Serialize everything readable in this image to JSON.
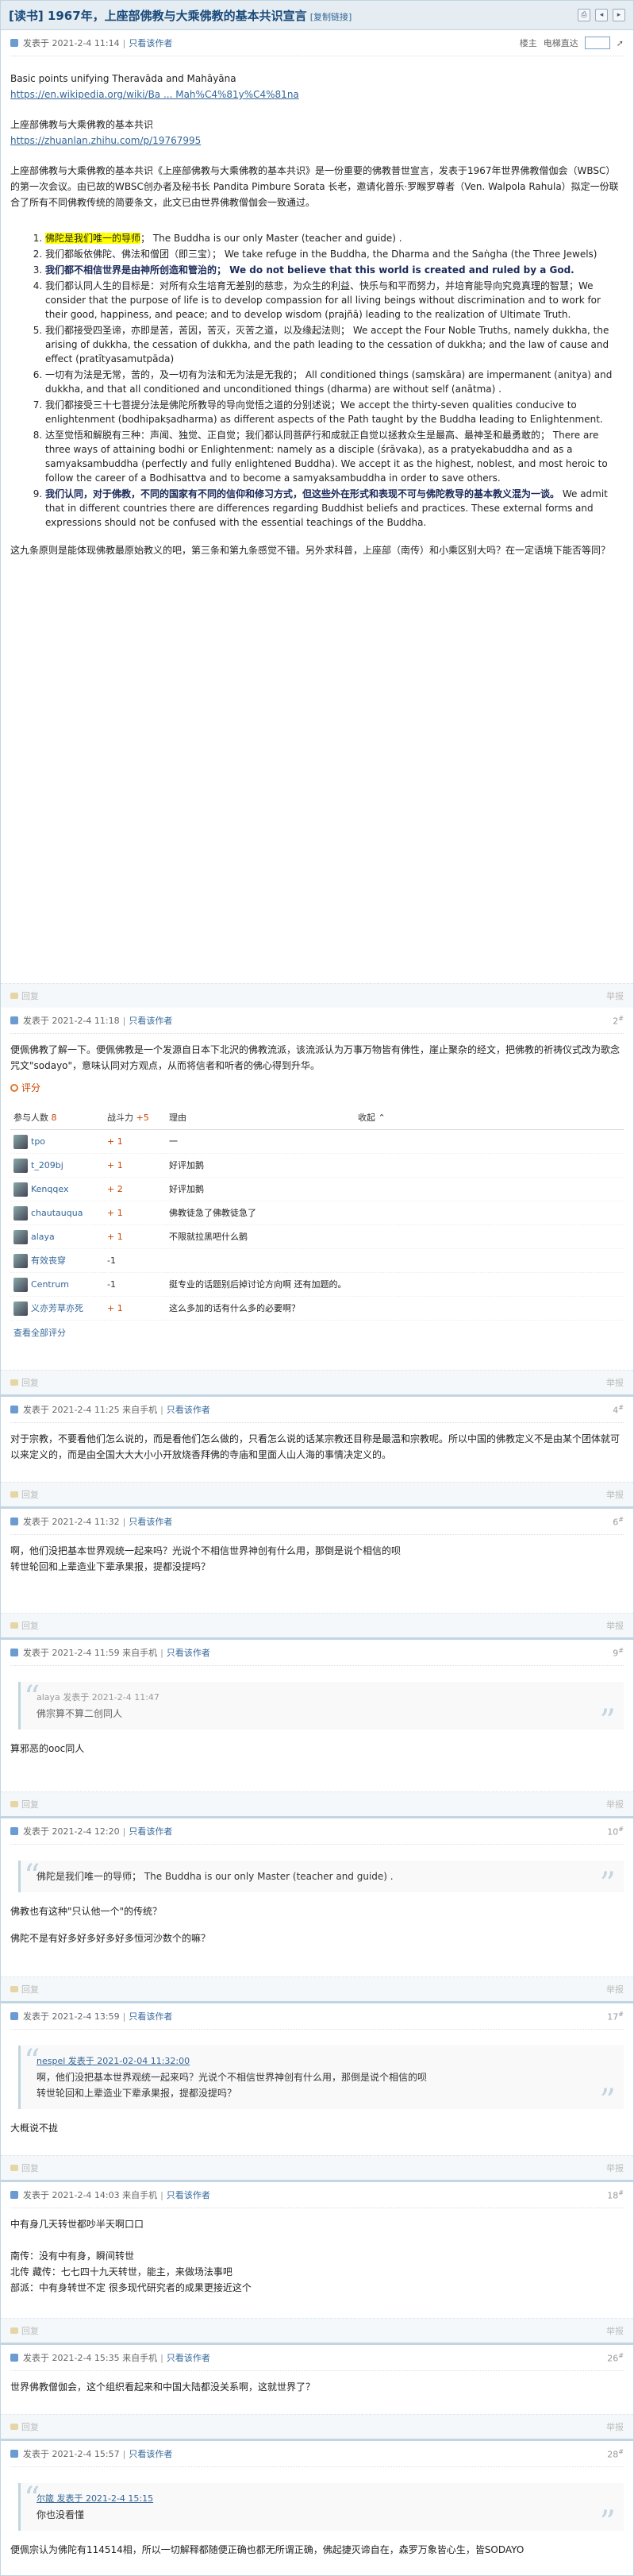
{
  "thread": {
    "title": "[读书] 1967年，上座部佛教与大乘佛教的基本共识宣言",
    "copy_link": "[复制链接]"
  },
  "p1": {
    "meta": "发表于 2021-2-4 11:14",
    "author_only": "只看该作者",
    "ctrl_a": "楼主",
    "ctrl_b": "电梯直达",
    "line1": "Basic points unifying Theravāda and Mahāyāna",
    "link1": "https://en.wikipedia.org/wiki/Ba ... Mah%C4%81y%C4%81na",
    "line2": "上座部佛教与大乘佛教的基本共识",
    "link2": "https://zhuanlan.zhihu.com/p/19767995",
    "intro": "上座部佛教与大乘佛教的基本共识《上座部佛教与大乘佛教的基本共识》是一份重要的佛教普世宣言，发表于1967年世界佛教僧伽会（WBSC）的第一次会议。由已故的WBSC创办者及秘书长 Pandita Pimbure Sorata 长老，邀请化普乐·罗睺罗尊者（Ven. Walpola Rahula）拟定一份联合了所有不同佛教传统的简要条文，此文已由世界佛教僧伽会一致通过。",
    "items": [
      {
        "hl": "佛陀是我们唯一的导师",
        "rest": "； The Buddha is our only Master (teacher and guide) ."
      },
      {
        "hl": "",
        "rest": "我们都皈依佛陀、佛法和僧团（即三宝）； We take refuge in the Buddha, the Dharma and the Saṅgha (the Three Jewels)"
      },
      {
        "hl": "",
        "bold": "我们都不相信世界是由神所创造和管治的； We do not believe that this world is created and ruled by a God.",
        "rest": ""
      },
      {
        "hl": "",
        "rest": "我们都认同人生的目标是：对所有众生培育无差别的慈悲，为众生的利益、快乐与和平而努力，并培育能导向究竟真理的智慧；We consider that the purpose of life is to develop compassion for all living beings without discrimination and to work for their good, happiness, and peace; and to develop wisdom (prajñā) leading to the realization of Ultimate Truth."
      },
      {
        "hl": "",
        "rest": "我们都接受四圣谛，亦即是苦，苦因，苦灭，灭苦之道，以及缘起法则； We accept the Four Noble Truths, namely dukkha, the arising of dukkha, the cessation of dukkha, and the path leading to the cessation of dukkha; and the law of cause and effect (pratītyasamutpāda)"
      },
      {
        "hl": "",
        "rest": "一切有为法是无常，苦的，及一切有为法和无为法是无我的； All conditioned things (saṃskāra) are impermanent (anitya) and dukkha, and that all conditioned and unconditioned things (dharma) are without self (anātma) ."
      },
      {
        "hl": "",
        "rest": "我们都接受三十七菩提分法是佛陀所教导的导向觉悟之道的分别述说；We accept the thirty-seven qualities conducive to enlightenment (bodhipakṣadharma) as different aspects of the Path taught by the Buddha leading to Enlightenment."
      },
      {
        "hl": "",
        "rest": "达至觉悟和解脱有三种：声闻、独觉、正自觉；我们都认同菩萨行和成就正自觉以拯救众生是最高、最神圣和最勇敢的； There are three ways of attaining bodhi or Enlightenment: namely as a disciple (śrāvaka), as a pratyekabuddha and as a samyaksambuddha (perfectly and fully enlightened Buddha). We accept it as the highest, noblest, and most heroic to follow the career of a Bodhisattva and to become a samyaksambuddha in order to save others."
      },
      {
        "hl": "",
        "bold": "我们认同，对于佛教，不同的国家有不同的信仰和修习方式，但这些外在形式和表现不可与佛陀教导的基本教义混为一谈。",
        "rest": " We admit that in different countries there are differences regarding Buddhist beliefs and practices. These external forms and expressions should not be confused with the essential teachings of the Buddha."
      }
    ],
    "outro": "这九条原则是能体现佛教最原始教义的吧，第三条和第九条感觉不错。另外求科普，上座部（南传）和小乘区别大吗？在一定语境下能否等同？",
    "reply": "回复",
    "report": "举报"
  },
  "p2": {
    "meta": "发表于 2021-2-4 11:18",
    "author_only": "只看该作者",
    "floor": "2",
    "body": "便佩佛教了解一下。便佩佛教是一个发源自日本下北沢的佛教流派，该流派认为万事万物皆有佛性，崖止聚杂的经文，把佛教的祈祷仪式改为歌念咒文\"sodayo\"，意味认同对方观点，从而将信者和听者的佛心得到升华。",
    "rate_title": "评分",
    "rate_cols": {
      "users": "参与人数",
      "users_n": "8",
      "power": "战斗力",
      "power_n": "+5",
      "reason": "理由",
      "collapse": "收起"
    },
    "rates": [
      {
        "user": "tpo",
        "delta": "+ 1",
        "reason": "一",
        "sign": "plus"
      },
      {
        "user": "t_209bj",
        "delta": "+ 1",
        "reason": "好评加鹅",
        "sign": "plus"
      },
      {
        "user": "Kenqqex",
        "delta": "+ 2",
        "reason": "好评加鹅",
        "sign": "plus"
      },
      {
        "user": "chautauqua",
        "delta": "+ 1",
        "reason": "佛教徒急了佛教徒急了",
        "sign": "plus"
      },
      {
        "user": "alaya",
        "delta": "+ 1",
        "reason": "不限就拉黑吧什么鹅",
        "sign": "plus"
      },
      {
        "user": "有效丧穿",
        "delta": "-1",
        "reason": "",
        "sign": "minus"
      },
      {
        "user": "Centrum",
        "delta": "-1",
        "reason": "挺专业的话题别后掉讨论方向啊 还有加题的。",
        "sign": "minus"
      },
      {
        "user": "义亦芳草亦死",
        "delta": "+ 1",
        "reason": "这么多加的话有什么多的必要啊？",
        "sign": "plus"
      }
    ],
    "view_all": "查看全部评分"
  },
  "p4": {
    "meta": "发表于 2021-2-4 11:25 来自手机",
    "author_only": "只看该作者",
    "floor": "4",
    "body": "对于宗教，不要看他们怎么说的，而是看他们怎么做的，只看怎么说的话某宗教还目称是最温和宗教呢。所以中国的佛教定义不是由某个团体就可以来定义的，而是由全国大大大小小开放烧香拜佛的寺庙和里面人山人海的事情决定义的。"
  },
  "p6": {
    "meta": "发表于 2021-2-4 11:32",
    "author_only": "只看该作者",
    "floor": "6",
    "body": "啊，他们没把基本世界观统一起来吗？光说个不相信世界神创有什么用，那倒是说个相信的呗\n转世轮回和上辈造业下辈承果报，提都没提吗？"
  },
  "p9": {
    "meta": "发表于 2021-2-4 11:59 来自手机",
    "author_only": "只看该作者",
    "floor": "9",
    "quote_head": "alaya 发表于 2021-2-4 11:47",
    "quote_body": "佛宗算不算二创同人",
    "body": "算邪恶的ooc同人"
  },
  "p10": {
    "meta": "发表于 2021-2-4 12:20",
    "author_only": "只看该作者",
    "floor": "10",
    "quote_body": "佛陀是我们唯一的导师； The Buddha is our only Master (teacher and guide) .",
    "body1": "佛教也有这种\"只认他一个\"的传统？",
    "body2": "佛陀不是有好多好多好多好多恒河沙数个的嘛？"
  },
  "p17": {
    "meta": "发表于 2021-2-4 13:59",
    "author_only": "只看该作者",
    "floor": "17",
    "quote_head": "nespel 发表于 2021-02-04 11:32:00",
    "quote_body": "啊，他们没把基本世界观统一起来吗？光说个不相信世界神创有什么用，那倒是说个相信的呗\n转世轮回和上辈造业下辈承果报，提都没提吗？",
    "body": "大概说不拢"
  },
  "p18": {
    "meta": "发表于 2021-2-4 14:03 来自手机",
    "author_only": "只看该作者",
    "floor": "18",
    "body": "中有身几天转世都吵半天啊口口\n\n南传：没有中有身，瞬间转世\n北传 藏传：七七四十九天转世，能主，来做场法事吧\n部派：中有身转世不定 很多现代研究者的成果更接近这个"
  },
  "p26": {
    "meta": "发表于 2021-2-4 15:35 来自手机",
    "author_only": "只看该作者",
    "floor": "26",
    "body": "世界佛教僧伽会，这个组织看起来和中国大陆都没关系啊，这就世界了？"
  },
  "p28": {
    "meta": "发表于 2021-2-4 15:57",
    "author_only": "只看该作者",
    "floor": "28",
    "quote_head": "尔箴 发表于 2021-2-4 15:15",
    "quote_body": "你也没看懂",
    "body": "便佩宗认为佛陀有114514相，所以一切解释都随便正确也都无所谓正确，佛起捷灭谛自在，森罗万象皆心生，皆SODAYO"
  },
  "common": {
    "reply": "回复",
    "report": "举报"
  }
}
